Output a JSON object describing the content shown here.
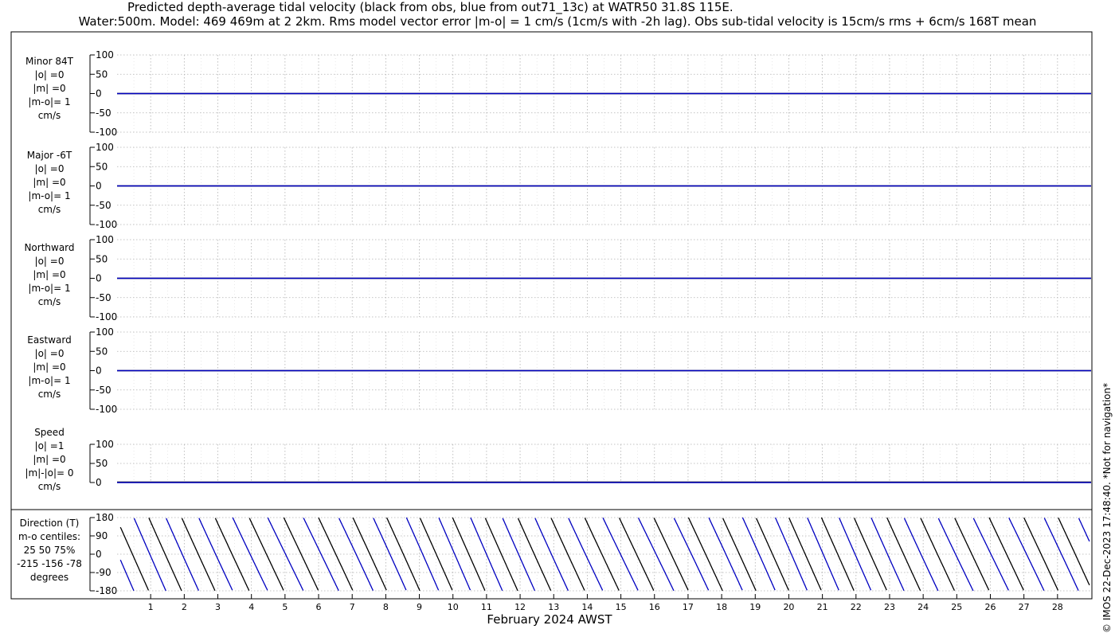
{
  "title": {
    "line1": "Predicted depth-average tidal velocity (black from obs, blue from out71_13c) at WATR50 31.8S 115E.",
    "line2": "Water:500m. Model: 469 469m at 2 2km. Rms model vector error |m-o| = 1 cm/s (1cm/s with -2h lag). Obs sub-tidal velocity is 15cm/s rms + 6cm/s 168T mean"
  },
  "credit": "© IMOS 22-Dec-2023 17:48:40. *Not for navigation*",
  "colors": {
    "obs": "#000000",
    "model": "#0000c0",
    "grid": "#b0b0b0"
  },
  "chart_data": [
    {
      "type": "line",
      "id": "minor",
      "ylabel": [
        "Minor 84T",
        "|o| =0",
        "|m| =0",
        "|m-o|= 1",
        "cm/s"
      ],
      "ylim": [
        -100,
        100
      ],
      "yticks": [
        "100",
        "50",
        "0",
        "-50",
        "-100"
      ],
      "series": [
        {
          "name": "obs",
          "constant": 0
        },
        {
          "name": "model",
          "constant": 0
        }
      ]
    },
    {
      "type": "line",
      "id": "major",
      "ylabel": [
        "Major -6T",
        "|o| =0",
        "|m| =0",
        "|m-o|= 1",
        "cm/s"
      ],
      "ylim": [
        -100,
        100
      ],
      "yticks": [
        "100",
        "50",
        "0",
        "-50",
        "-100"
      ],
      "series": [
        {
          "name": "obs",
          "constant": 0
        },
        {
          "name": "model",
          "constant": 0
        }
      ]
    },
    {
      "type": "line",
      "id": "north",
      "ylabel": [
        "Northward",
        "|o| =0",
        "|m| =0",
        "|m-o|= 1",
        "cm/s"
      ],
      "ylim": [
        -100,
        100
      ],
      "yticks": [
        "100",
        "50",
        "0",
        "-50",
        "-100"
      ],
      "series": [
        {
          "name": "obs",
          "constant": 0
        },
        {
          "name": "model",
          "constant": 0
        }
      ]
    },
    {
      "type": "line",
      "id": "east",
      "ylabel": [
        "Eastward",
        "|o| =0",
        "|m| =0",
        "|m-o|= 1",
        "cm/s"
      ],
      "ylim": [
        -100,
        100
      ],
      "yticks": [
        "100",
        "50",
        "0",
        "-50",
        "-100"
      ],
      "series": [
        {
          "name": "obs",
          "constant": 0
        },
        {
          "name": "model",
          "constant": 0
        }
      ]
    },
    {
      "type": "line",
      "id": "speed",
      "ylabel": [
        "Speed",
        "|o| =1",
        "|m| =0",
        "|m|-|o|= 0",
        "cm/s"
      ],
      "ylim": [
        0,
        100
      ],
      "yticks": [
        "100",
        "50",
        "0"
      ],
      "series": [
        {
          "name": "obs",
          "constant": 1
        },
        {
          "name": "model",
          "constant": 0
        }
      ]
    },
    {
      "type": "line",
      "id": "direction",
      "ylabel": [
        "Direction (T)",
        "m-o centiles:",
        "25  50  75%",
        "-215 -156  -78",
        "degrees"
      ],
      "ylim": [
        -180,
        180
      ],
      "yticks": [
        "180",
        "90",
        "0",
        "-90",
        "-180"
      ],
      "series": [
        {
          "name": "obs",
          "pattern": "sawtooth",
          "cycles_per_day": 1.0,
          "range": [
            -180,
            180
          ]
        },
        {
          "name": "model",
          "pattern": "sawtooth",
          "cycles_per_day": 1.0,
          "range": [
            -180,
            180
          ]
        }
      ]
    }
  ],
  "xaxis": {
    "label": "February 2024 AWST",
    "xlim": [
      0,
      29
    ],
    "ticks": [
      "1",
      "2",
      "3",
      "4",
      "5",
      "6",
      "7",
      "8",
      "9",
      "10",
      "11",
      "12",
      "13",
      "14",
      "15",
      "16",
      "17",
      "18",
      "19",
      "20",
      "21",
      "22",
      "23",
      "24",
      "25",
      "26",
      "27",
      "28"
    ]
  }
}
